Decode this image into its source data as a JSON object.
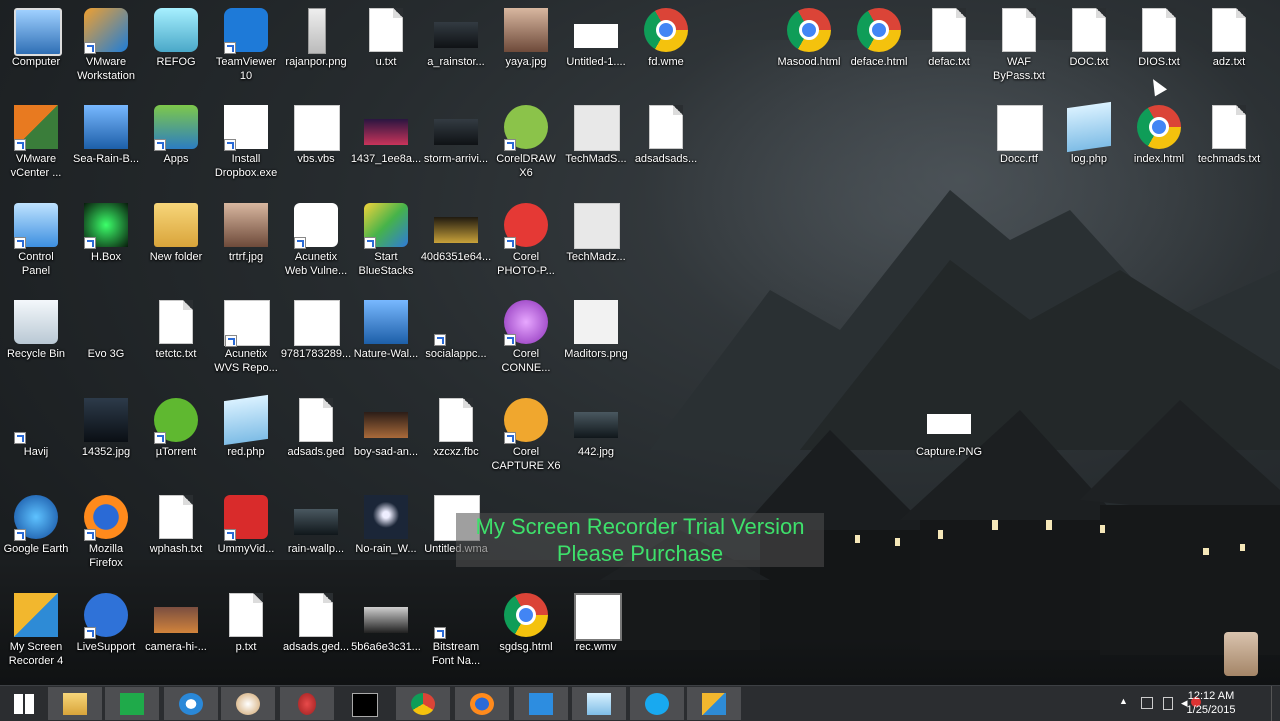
{
  "desktop_icons": [
    {
      "name": "computer",
      "label": "Computer",
      "kind": "computer"
    },
    {
      "name": "vmware-workstation",
      "label": "VMware\nWorkstation",
      "kind": "vmware"
    },
    {
      "name": "refog",
      "label": "REFOG",
      "kind": "refog"
    },
    {
      "name": "teamviewer",
      "label": "TeamViewer\n10",
      "kind": "teamviewer"
    },
    {
      "name": "rajanpor-png",
      "label": "rajanpor.png",
      "kind": "tall"
    },
    {
      "name": "u-txt",
      "label": "u.txt",
      "kind": "doc"
    },
    {
      "name": "a-rainstorm",
      "label": "a_rainstor...",
      "kind": "dark"
    },
    {
      "name": "yaya-jpg",
      "label": "yaya.jpg",
      "kind": "portrait"
    },
    {
      "name": "untitled-1",
      "label": "Untitled-1....",
      "kind": "white"
    },
    {
      "name": "fd-wme",
      "label": "fd.wme",
      "kind": "chrome"
    },
    {
      "name": "masood-html",
      "label": "Masood.html",
      "kind": "chrome"
    },
    {
      "name": "deface-html",
      "label": "deface.html",
      "kind": "chrome"
    },
    {
      "name": "defac-txt",
      "label": "defac.txt",
      "kind": "doc"
    },
    {
      "name": "waf-bypass-txt",
      "label": "WAF\nByPass.txt",
      "kind": "doc"
    },
    {
      "name": "doc-txt",
      "label": "DOC.txt",
      "kind": "doc"
    },
    {
      "name": "dios-txt",
      "label": "DIOS.txt",
      "kind": "doc"
    },
    {
      "name": "adz-txt",
      "label": "adz.txt",
      "kind": "doc"
    },
    {
      "name": "vmware-vcenter",
      "label": "VMware\nvCenter ...",
      "kind": "vcenter"
    },
    {
      "name": "sea-rain",
      "label": "Sea-Rain-B...",
      "kind": "sea"
    },
    {
      "name": "apps",
      "label": "Apps",
      "kind": "apps"
    },
    {
      "name": "install-dropbox",
      "label": "Install\nDropbox.exe",
      "kind": "dropbox"
    },
    {
      "name": "vbs-vbs",
      "label": "vbs.vbs",
      "kind": "vbs"
    },
    {
      "name": "1437-img",
      "label": "1437_1ee8a...",
      "kind": "sunset"
    },
    {
      "name": "storm-arriving",
      "label": "storm-arrivi...",
      "kind": "dark"
    },
    {
      "name": "coreldraw",
      "label": "CorelDRAW\nX6",
      "kind": "corel"
    },
    {
      "name": "techmads-s",
      "label": "TechMadS...",
      "kind": "techmads"
    },
    {
      "name": "adsadsads-1",
      "label": "adsadsads...",
      "kind": "doc"
    },
    {
      "name": "docc-rtf",
      "label": "Docc.rtf",
      "kind": "rtf"
    },
    {
      "name": "log-php",
      "label": "log.php",
      "kind": "notepad"
    },
    {
      "name": "index-html",
      "label": "index.html",
      "kind": "chrome"
    },
    {
      "name": "techmads-txt",
      "label": "techmads.txt",
      "kind": "doc"
    },
    {
      "name": "control-panel",
      "label": "Control\nPanel",
      "kind": "control"
    },
    {
      "name": "hbox",
      "label": "H.Box",
      "kind": "hbox"
    },
    {
      "name": "new-folder",
      "label": "New folder",
      "kind": "folder"
    },
    {
      "name": "trtrf-jpg",
      "label": "trtrf.jpg",
      "kind": "portrait"
    },
    {
      "name": "acunetix-web",
      "label": "Acunetix\nWeb Vulne...",
      "kind": "acunetix"
    },
    {
      "name": "start-bluestacks",
      "label": "Start\nBlueStacks",
      "kind": "bluestacks"
    },
    {
      "name": "40d6351e64",
      "label": "40d6351e64...",
      "kind": "gold"
    },
    {
      "name": "corel-photo-paint",
      "label": "Corel\nPHOTO-P...",
      "kind": "photopaint"
    },
    {
      "name": "techmadz",
      "label": "TechMadz...",
      "kind": "techmads"
    },
    {
      "name": "recycle-bin",
      "label": "Recycle Bin",
      "kind": "recycle"
    },
    {
      "name": "evo-3g",
      "label": "Evo 3G",
      "kind": "evo"
    },
    {
      "name": "tetctc-txt",
      "label": "tetctc.txt",
      "kind": "doc"
    },
    {
      "name": "acunetix-wvs",
      "label": "Acunetix\nWVS Repo...",
      "kind": "wvs"
    },
    {
      "name": "9781783289",
      "label": "9781783289...",
      "kind": "pdf"
    },
    {
      "name": "nature-wal",
      "label": "Nature-Wal...",
      "kind": "sea"
    },
    {
      "name": "socialapp",
      "label": "socialappc...",
      "kind": "social"
    },
    {
      "name": "corel-connect",
      "label": "Corel\nCONNE...",
      "kind": "connect"
    },
    {
      "name": "maditors-png",
      "label": "Maditors.png",
      "kind": "maditors"
    },
    {
      "name": "havij",
      "label": "Havij",
      "kind": "havij"
    },
    {
      "name": "14352-jpg",
      "label": "14352.jpg",
      "kind": "batman"
    },
    {
      "name": "utorrent",
      "label": "µTorrent",
      "kind": "utorrent"
    },
    {
      "name": "red-php",
      "label": "red.php",
      "kind": "notepad"
    },
    {
      "name": "adsads-ged",
      "label": "adsads.ged",
      "kind": "doc"
    },
    {
      "name": "boy-sad",
      "label": "boy-sad-an...",
      "kind": "sunset2"
    },
    {
      "name": "xzcxz-fbc",
      "label": "xzcxz.fbc",
      "kind": "doc"
    },
    {
      "name": "corel-capture",
      "label": "Corel\nCAPTURE X6",
      "kind": "capture"
    },
    {
      "name": "442-jpg",
      "label": "442.jpg",
      "kind": "dark2"
    },
    {
      "name": "capture-png",
      "label": "Capture.PNG",
      "kind": "capturepng"
    },
    {
      "name": "google-earth",
      "label": "Google Earth",
      "kind": "earth"
    },
    {
      "name": "mozilla-firefox",
      "label": "Mozilla\nFirefox",
      "kind": "firefox"
    },
    {
      "name": "wphash-txt",
      "label": "wphash.txt",
      "kind": "doc"
    },
    {
      "name": "ummyvideo",
      "label": "UmmyVid...",
      "kind": "ummy"
    },
    {
      "name": "rain-wallp",
      "label": "rain-wallp...",
      "kind": "dark2"
    },
    {
      "name": "no-rain",
      "label": "No-rain_W...",
      "kind": "moon"
    },
    {
      "name": "untitled-wma",
      "label": "Untitled.wma",
      "kind": "wma"
    },
    {
      "name": "my-screen-recorder",
      "label": "My Screen\nRecorder 4",
      "kind": "recorder"
    },
    {
      "name": "livesupport",
      "label": "LiveSupport",
      "kind": "livesupport"
    },
    {
      "name": "camera-hi",
      "label": "camera-hi-...",
      "kind": "camera"
    },
    {
      "name": "p-txt",
      "label": "p.txt",
      "kind": "doc"
    },
    {
      "name": "adsads-ged-2",
      "label": "adsads.ged...",
      "kind": "doc"
    },
    {
      "name": "5b6a6e3c31",
      "label": "5b6a6e3c31...",
      "kind": "bw"
    },
    {
      "name": "bitstream-font",
      "label": "Bitstream\nFont Na...",
      "kind": "bitstream"
    },
    {
      "name": "sgdsg-html",
      "label": "sgdsg.html",
      "kind": "chrome"
    },
    {
      "name": "rec-wmv",
      "label": "rec.wmv",
      "kind": "wmv"
    }
  ],
  "shortcut_overlay_names": [
    "vmware-workstation",
    "teamviewer",
    "vmware-vcenter",
    "apps",
    "install-dropbox",
    "coreldraw",
    "control-panel",
    "hbox",
    "acunetix-web",
    "start-bluestacks",
    "corel-photo-paint",
    "acunetix-wvs",
    "socialapp",
    "corel-connect",
    "havij",
    "utorrent",
    "corel-capture",
    "google-earth",
    "mozilla-firefox",
    "ummyvideo",
    "livesupport",
    "bitstream-font"
  ],
  "watermark": {
    "line1": "My Screen Recorder Trial Version",
    "line2": "Please Purchase"
  },
  "taskbar": {
    "apps": [
      {
        "name": "start",
        "icon": "windows-logo"
      },
      {
        "name": "file-explorer",
        "icon": "folder"
      },
      {
        "name": "store",
        "icon": "store"
      },
      {
        "name": "internet-explorer",
        "icon": "ie"
      },
      {
        "name": "paint",
        "icon": "palette"
      },
      {
        "name": "snipping-tool",
        "icon": "scissors"
      },
      {
        "name": "command-prompt",
        "icon": "cmd"
      },
      {
        "name": "chrome",
        "icon": "chrome"
      },
      {
        "name": "firefox",
        "icon": "firefox"
      },
      {
        "name": "dropbox",
        "icon": "dropbox"
      },
      {
        "name": "notepad",
        "icon": "notepad"
      },
      {
        "name": "skype",
        "icon": "skype"
      },
      {
        "name": "my-screen-recorder",
        "icon": "recorder"
      }
    ],
    "time": "12:12 AM",
    "date": "1/25/2015"
  },
  "colors": {
    "watermark_text": "#3ee06b",
    "taskbar": "#2b2d30"
  }
}
